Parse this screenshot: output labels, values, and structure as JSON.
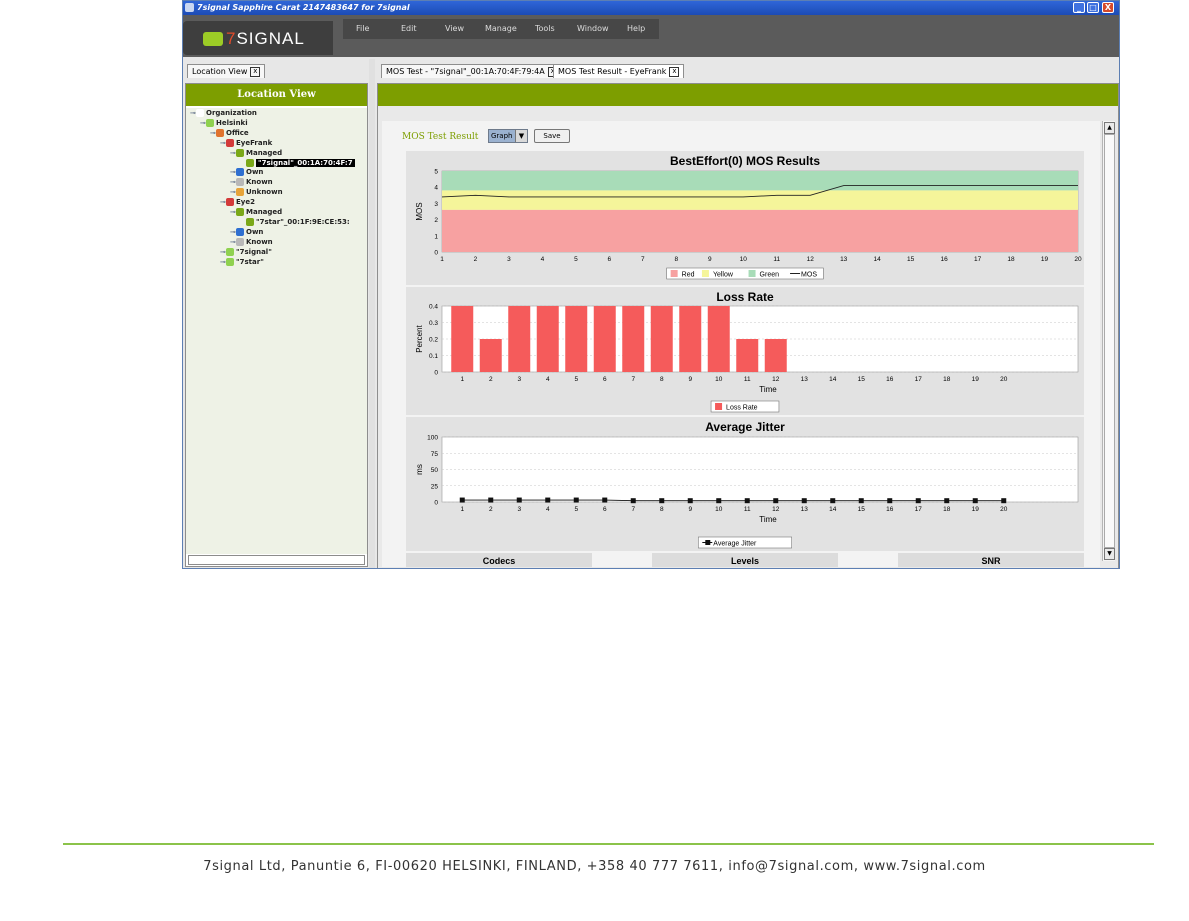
{
  "window": {
    "title": "7signal Sapphire Carat  2147483647 for 7signal",
    "minimize": "_",
    "maximize": "□",
    "close": "X"
  },
  "header": {
    "logo_seven": "7",
    "logo_text": "SIGNAL",
    "menu": [
      "File",
      "Edit",
      "View",
      "Manage",
      "Tools",
      "Window",
      "Help"
    ]
  },
  "left_pane": {
    "tab_label": "Location View",
    "header": "Location View",
    "tree": [
      {
        "label": "Organization",
        "indent": 0,
        "icon": "org-icon"
      },
      {
        "label": "Helsinki",
        "indent": 1,
        "icon": "city-icon"
      },
      {
        "label": "Office",
        "indent": 2,
        "icon": "office-icon"
      },
      {
        "label": "EyeFrank",
        "indent": 3,
        "icon": "eye-icon"
      },
      {
        "label": "Managed",
        "indent": 4,
        "icon": "managed-icon"
      },
      {
        "label": "\"7signal\"_00:1A:70:4F:7",
        "indent": 5,
        "icon": "ap-icon",
        "selected": true
      },
      {
        "label": "Own",
        "indent": 4,
        "icon": "own-icon"
      },
      {
        "label": "Known",
        "indent": 4,
        "icon": "known-icon"
      },
      {
        "label": "Unknown",
        "indent": 4,
        "icon": "unknown-icon"
      },
      {
        "label": "Eye2",
        "indent": 3,
        "icon": "eye-icon"
      },
      {
        "label": "Managed",
        "indent": 4,
        "icon": "managed-icon"
      },
      {
        "label": "\"7star\"_00:1F:9E:CE:53:",
        "indent": 5,
        "icon": "ap-icon"
      },
      {
        "label": "Own",
        "indent": 4,
        "icon": "own-icon"
      },
      {
        "label": "Known",
        "indent": 4,
        "icon": "known-icon"
      },
      {
        "label": "\"7signal\"",
        "indent": 3,
        "icon": "ssid-icon"
      },
      {
        "label": "\"7star\"",
        "indent": 3,
        "icon": "ssid-icon"
      }
    ]
  },
  "right_pane": {
    "tabs": [
      {
        "label": "MOS Test - \"7signal\"_00:1A:70:4F:79:4A"
      },
      {
        "label": "MOS Test Result - EyeFrank"
      }
    ],
    "toolbar": {
      "result_label": "MOS Test Result",
      "view_select": "Graph",
      "save_label": "Save"
    },
    "bottom_headers": [
      "Codecs",
      "Levels",
      "SNR"
    ]
  },
  "colors": {
    "brand_green": "#7d9e00",
    "zone_red": "#f7a1a1",
    "zone_yellow": "#f5f59a",
    "zone_green": "#a8dcb8",
    "bar_red": "#f55b5b"
  },
  "chart_data": [
    {
      "type": "area",
      "title": "BestEffort(0) MOS Results",
      "xlabel": "",
      "ylabel": "MOS",
      "x": [
        1,
        2,
        3,
        4,
        5,
        6,
        7,
        8,
        9,
        10,
        11,
        12,
        13,
        14,
        15,
        16,
        17,
        18,
        19,
        20
      ],
      "ylim": [
        0,
        5
      ],
      "yticks": [
        0,
        1,
        2,
        3,
        4,
        5
      ],
      "bands": [
        {
          "name": "Red",
          "from": 0,
          "to": 2.6,
          "color": "#f7a1a1"
        },
        {
          "name": "Yellow",
          "from": 2.6,
          "to": 3.8,
          "color": "#f5f59a"
        },
        {
          "name": "Green",
          "from": 3.8,
          "to": 5,
          "color": "#a8dcb8"
        }
      ],
      "series": [
        {
          "name": "MOS",
          "values": [
            3.4,
            3.5,
            3.4,
            3.4,
            3.4,
            3.4,
            3.4,
            3.4,
            3.4,
            3.4,
            3.5,
            3.5,
            4.1,
            4.1,
            4.1,
            4.1,
            4.1,
            4.1,
            4.1,
            4.1
          ]
        }
      ],
      "legend": [
        "Red",
        "Yellow",
        "Green",
        "MOS"
      ],
      "legend_position": "bottom",
      "grid": false
    },
    {
      "type": "bar",
      "title": "Loss Rate",
      "xlabel": "Time",
      "ylabel": "Percent",
      "categories": [
        "1",
        "2",
        "3",
        "4",
        "5",
        "6",
        "7",
        "8",
        "9",
        "10",
        "11",
        "12",
        "13",
        "14",
        "15",
        "16",
        "17",
        "18",
        "19",
        "20"
      ],
      "series": [
        {
          "name": "Loss Rate",
          "values": [
            0.4,
            0.2,
            0.4,
            0.4,
            0.4,
            0.4,
            0.4,
            0.4,
            0.4,
            0.4,
            0.2,
            0.2,
            0,
            0,
            0,
            0,
            0,
            0,
            0,
            0
          ]
        }
      ],
      "ylim": [
        0,
        0.4
      ],
      "yticks": [
        0.0,
        0.1,
        0.2,
        0.3,
        0.4
      ],
      "legend_position": "bottom",
      "grid": true
    },
    {
      "type": "line",
      "title": "Average Jitter",
      "xlabel": "Time",
      "ylabel": "ms",
      "x": [
        1,
        2,
        3,
        4,
        5,
        6,
        7,
        8,
        9,
        10,
        11,
        12,
        13,
        14,
        15,
        16,
        17,
        18,
        19,
        20
      ],
      "series": [
        {
          "name": "Average Jitter",
          "values": [
            3,
            3,
            3,
            3,
            3,
            3,
            2,
            2,
            2,
            2,
            2,
            2,
            2,
            2,
            2,
            2,
            2,
            2,
            2,
            2
          ]
        }
      ],
      "ylim": [
        0,
        100
      ],
      "yticks": [
        0,
        25,
        50,
        75,
        100
      ],
      "legend_position": "bottom",
      "grid": true
    }
  ],
  "footer": {
    "text": "7signal Ltd, Panuntie 6, FI-00620 HELSINKI, FINLAND, +358 40 777 7611, info@7signal.com, www.7signal.com"
  }
}
